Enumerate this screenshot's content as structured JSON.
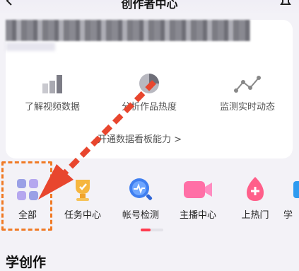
{
  "header": {
    "title": "创作者中心"
  },
  "features": [
    {
      "label": "了解视频数据",
      "icon": "bar-chart-icon"
    },
    {
      "label": "分析作品热度",
      "icon": "pie-chart-icon"
    },
    {
      "label": "监测实时动态",
      "icon": "line-trend-icon"
    }
  ],
  "open_link": "开通数据看板能力 >",
  "tools": [
    {
      "label": "全部",
      "icon": "grid-icon"
    },
    {
      "label": "任务中心",
      "icon": "trophy-icon"
    },
    {
      "label": "帐号检测",
      "icon": "magnifier-icon"
    },
    {
      "label": "主播中心",
      "icon": "video-camera-icon"
    },
    {
      "label": "上热门",
      "icon": "flame-icon"
    },
    {
      "label": "学",
      "icon": "book-icon"
    }
  ],
  "section_title": "学创作",
  "colors": {
    "accent": "#ff3b4f",
    "annotation": "#f07a25"
  }
}
